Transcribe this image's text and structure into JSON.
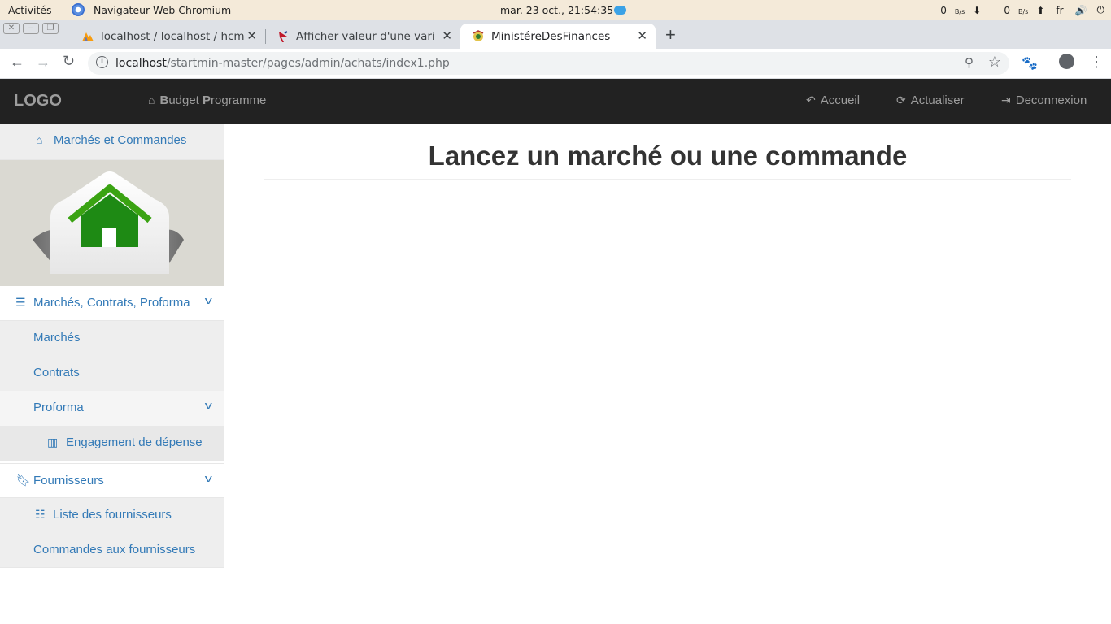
{
  "os_bar": {
    "activities": "Activités",
    "app_name": "Navigateur Web Chromium",
    "clock": "mar. 23 oct., 21:54:35",
    "net_down": "0",
    "net_down_unit": "B/s",
    "net_up": "0",
    "net_up_unit": "B/s",
    "language": "fr"
  },
  "browser": {
    "tabs": [
      {
        "title": "localhost / localhost / hcm",
        "favicon": "phpmyadmin-icon"
      },
      {
        "title": "Afficher valeur d'une vari",
        "favicon": "site-favicon"
      },
      {
        "title": "MinistéreDesFinances",
        "favicon": "emblem-favicon"
      }
    ],
    "url_host": "localhost",
    "url_path": "/startmin-master/pages/admin/achats/index1.php"
  },
  "navbar": {
    "brand": "LOGO",
    "budget_b": "B",
    "budget_rest": "udget ",
    "budget_p": "P",
    "budget_rest2": "rogramme",
    "accueil": "Accueil",
    "actualiser": "Actualiser",
    "deconnexion": "Deconnexion"
  },
  "sidebar": {
    "home": "Marchés et Commandes",
    "section1": "Marchés, Contrats, Proforma",
    "marches": "Marchés",
    "contrats": "Contrats",
    "proforma": "Proforma",
    "engagement": "Engagement de dépense",
    "fournisseurs": "Fournisseurs",
    "liste_fournisseurs": "Liste des fournisseurs",
    "commandes_fournisseurs": "Commandes aux fournisseurs"
  },
  "main": {
    "title": "Lancez un marché ou une commande"
  },
  "colors": {
    "link": "#337ab7",
    "navbar_bg": "#222222",
    "house_green": "#1e8a14"
  }
}
